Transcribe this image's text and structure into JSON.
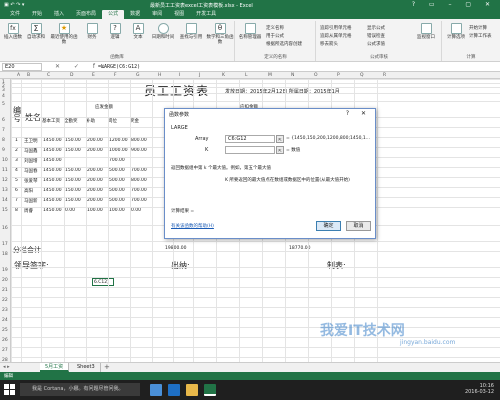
{
  "window": {
    "title": "最新员工工资表excel工资表模板.xlsx - Excel",
    "controls": "? ▭ – ▢ ✕"
  },
  "ribbon_tabs": [
    "文件",
    "开始",
    "插入",
    "页面布局",
    "公式",
    "数据",
    "审阅",
    "视图",
    "开发工具"
  ],
  "active_tab": "公式",
  "ribbon": {
    "insert_function": "插入函数",
    "autosum": "自动求和",
    "recent": "最近使用的函数",
    "financial": "财务",
    "logical": "逻辑",
    "text": "文本",
    "datetime": "日期和时间",
    "lookup": "查找与引用",
    "math": "数学和三角函数",
    "other": "其他函数",
    "group_library": "函数库",
    "name_manager": "名称管理器",
    "define_name": "定义名称",
    "use_in_formula": "用于公式",
    "create_from_sel": "根据所选内容创建",
    "group_names": "定义的名称",
    "trace_precedents": "追踪引用单元格",
    "trace_dependents": "追踪从属单元格",
    "remove_arrows": "移去箭头",
    "show_formulas": "显示公式",
    "error_check": "错误检查",
    "eval_formula": "公式求值",
    "group_audit": "公式审核",
    "watch_window": "监视窗口",
    "calc_options": "计算选项",
    "calc_now": "开始计算",
    "calc_sheet": "计算工作表",
    "group_calc": "计算"
  },
  "formula_bar": {
    "name_box": "E20",
    "fx_icons": "✕ ✓ fx",
    "formula": "=LARGE(C6:G12)"
  },
  "columns": [
    "A",
    "B",
    "C",
    "D",
    "E",
    "F",
    "G",
    "H",
    "I",
    "J",
    "K",
    "L",
    "M",
    "N",
    "O",
    "P",
    "Q",
    "R"
  ],
  "rows": [
    "1",
    "2",
    "3",
    "4",
    "5",
    "6",
    "7",
    "8",
    "9",
    "10",
    "11",
    "12",
    "13",
    "14",
    "15",
    "16",
    "17",
    "18",
    "19",
    "20",
    "21",
    "22",
    "23",
    "24",
    "25",
    "26",
    "27",
    "28",
    "29"
  ],
  "sheet": {
    "title": "员工工资表",
    "issue_date": "发放日期：2015年2月12日 所属日期：2015年1月",
    "hdr_no": "编号",
    "hdr_name": "姓名",
    "hdr_should": "应发金额",
    "hdr_deduct": "应扣金额",
    "sub_headers": [
      "基本工资",
      "全勤奖",
      "补助",
      "岗位",
      "奖金"
    ],
    "employees": [
      {
        "no": "1",
        "name": "王卫明",
        "vals": [
          "1450.00",
          "150.00",
          "200.00",
          "1200.00",
          "800.00"
        ]
      },
      {
        "no": "2",
        "name": "马国鑫",
        "vals": [
          "1450.00",
          "150.00",
          "200.00",
          "1000.00",
          "900.00"
        ]
      },
      {
        "no": "3",
        "name": "刘国增",
        "vals": [
          "1450.00",
          "",
          "",
          "700.00",
          ""
        ]
      },
      {
        "no": "4",
        "name": "马国春",
        "vals": [
          "1450.00",
          "150.00",
          "200.00",
          "500.00",
          "700.00"
        ]
      },
      {
        "no": "5",
        "name": "张爱琴",
        "vals": [
          "1450.00",
          "150.00",
          "200.00",
          "500.00",
          "800.00"
        ]
      },
      {
        "no": "6",
        "name": "高阳",
        "vals": [
          "1450.00",
          "150.00",
          "200.00",
          "500.00",
          "700.00"
        ]
      },
      {
        "no": "7",
        "name": "马国新",
        "vals": [
          "1450.00",
          "150.00",
          "200.00",
          "500.00",
          "700.00"
        ]
      },
      {
        "no": "8",
        "name": "周睿",
        "vals": [
          "1450.00",
          "0.00",
          "100.00",
          "100.00",
          "0.00"
        ]
      }
    ],
    "subtotal_label": "分栏合计",
    "subtotal_val1": "19800.00",
    "subtotal_val2": "18770.00",
    "leader": "领导签字:",
    "cashier": "出纳:",
    "maker": "制表:",
    "cell_e20": "6.C12)"
  },
  "dialog": {
    "title": "函数参数",
    "controls": "?  ✕",
    "function_name": "LARGE",
    "arg1_label": "Array",
    "arg1_value": "C6:G12",
    "arg1_result": "= {1450,150,200,1200,800;1450,1...",
    "arg2_label": "K",
    "arg2_value": "",
    "arg2_result": "= 数值",
    "description": "返回数据组中第 k 个最大值。例如，第五个最大值",
    "arg_description": "K   所要返回的最大值点在数组或数据区中的位置(从最大值开始)",
    "result_label": "计算结果 =",
    "help_link": "有关该函数的帮助(H)",
    "ok": "确定",
    "cancel": "取消"
  },
  "sheet_tabs": [
    "5月工资",
    "Sheet3"
  ],
  "active_sheet": "5月工资",
  "add_sheet": "+",
  "status": {
    "mode": "编辑"
  },
  "taskbar": {
    "search_placeholder": "我是 Cortana，小娜。有问题尽管问我。",
    "time": "10:16",
    "date": "2016-03-12"
  },
  "watermark": "我爱IT技术网",
  "watermark_url": "jingyan.baidu.com",
  "colors": {
    "excel_green": "#217346",
    "dialog_border": "#6a8ec9",
    "taskbar": "#1f1f1f"
  }
}
